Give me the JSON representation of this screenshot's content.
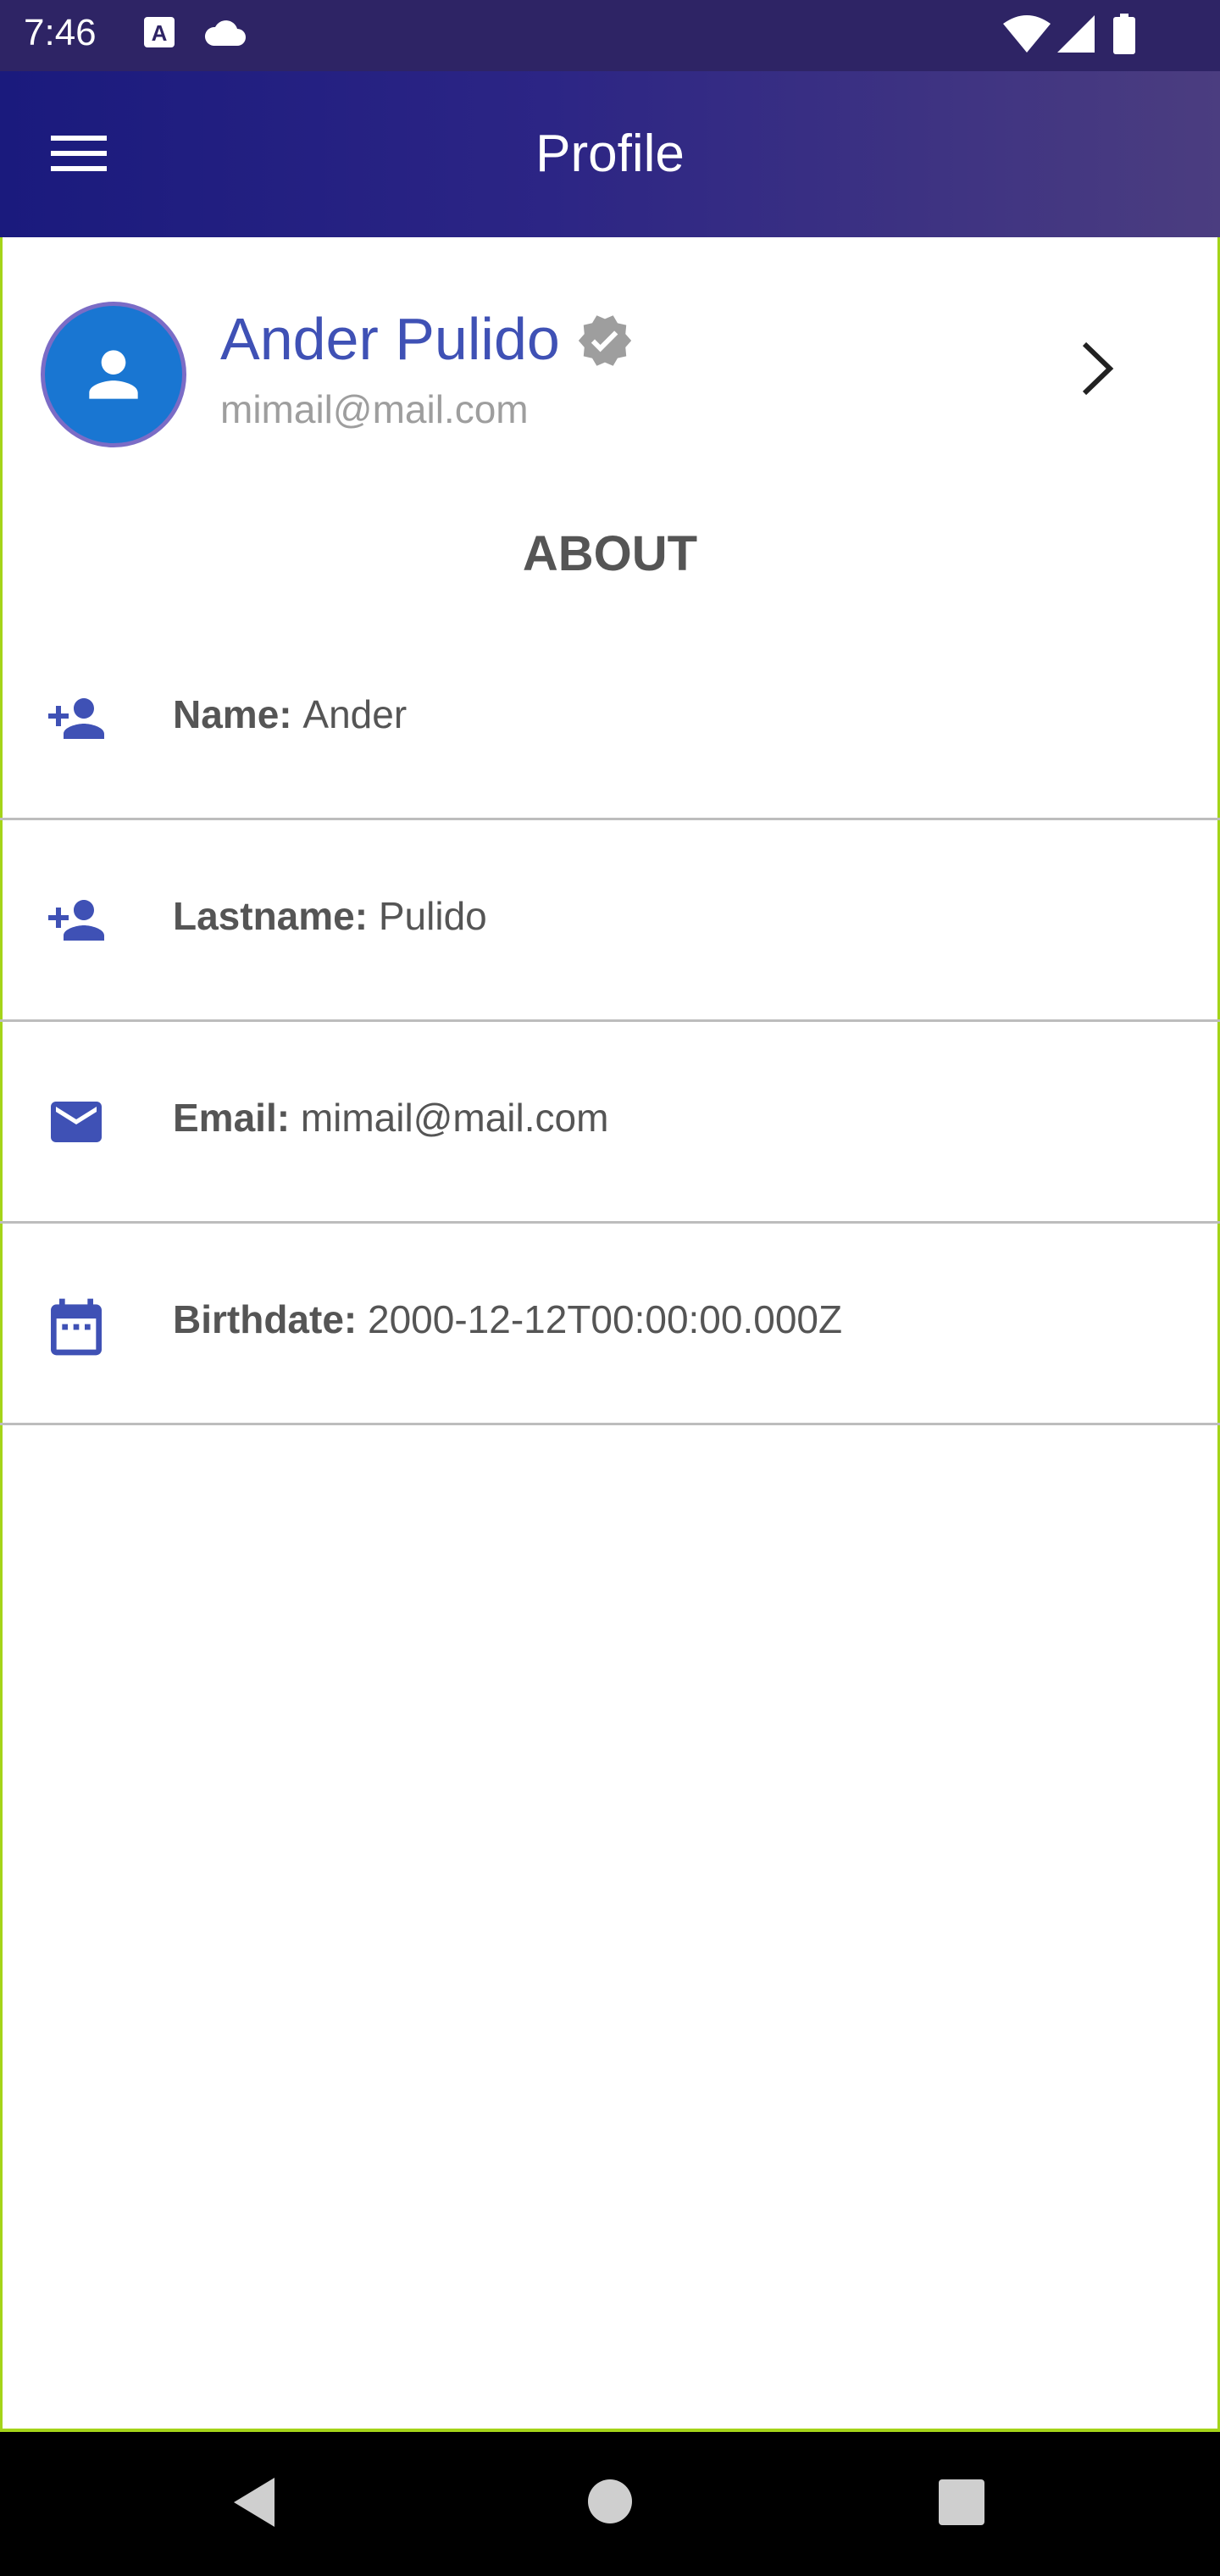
{
  "status_bar": {
    "time": "7:46",
    "icons": [
      "font-notification-icon",
      "cloud-icon",
      "wifi-icon",
      "signal-icon",
      "battery-icon"
    ]
  },
  "app_bar": {
    "title": "Profile",
    "menu_icon": "hamburger-menu-icon",
    "background": "#1a1a7d"
  },
  "profile": {
    "name": "Ander Pulido",
    "email": "mimail@mail.com",
    "avatar_icon": "person-icon",
    "verified_icon": "verified-badge-icon",
    "chevron_icon": "chevron-right-icon",
    "name_color": "#3f51b5",
    "avatar_color": "#1976d2"
  },
  "about": {
    "title": "ABOUT",
    "rows": [
      {
        "icon": "person-add-icon",
        "label": "Name:",
        "value": "Ander"
      },
      {
        "icon": "person-add-icon",
        "label": "Lastname:",
        "value": "Pulido"
      },
      {
        "icon": "email-icon",
        "label": "Email:",
        "value": "mimail@mail.com"
      },
      {
        "icon": "calendar-icon",
        "label": "Birthdate:",
        "value": "2000-12-12T00:00:00.000Z"
      }
    ]
  },
  "nav_bar": {
    "buttons": [
      "back-icon",
      "home-icon",
      "recents-icon"
    ]
  }
}
